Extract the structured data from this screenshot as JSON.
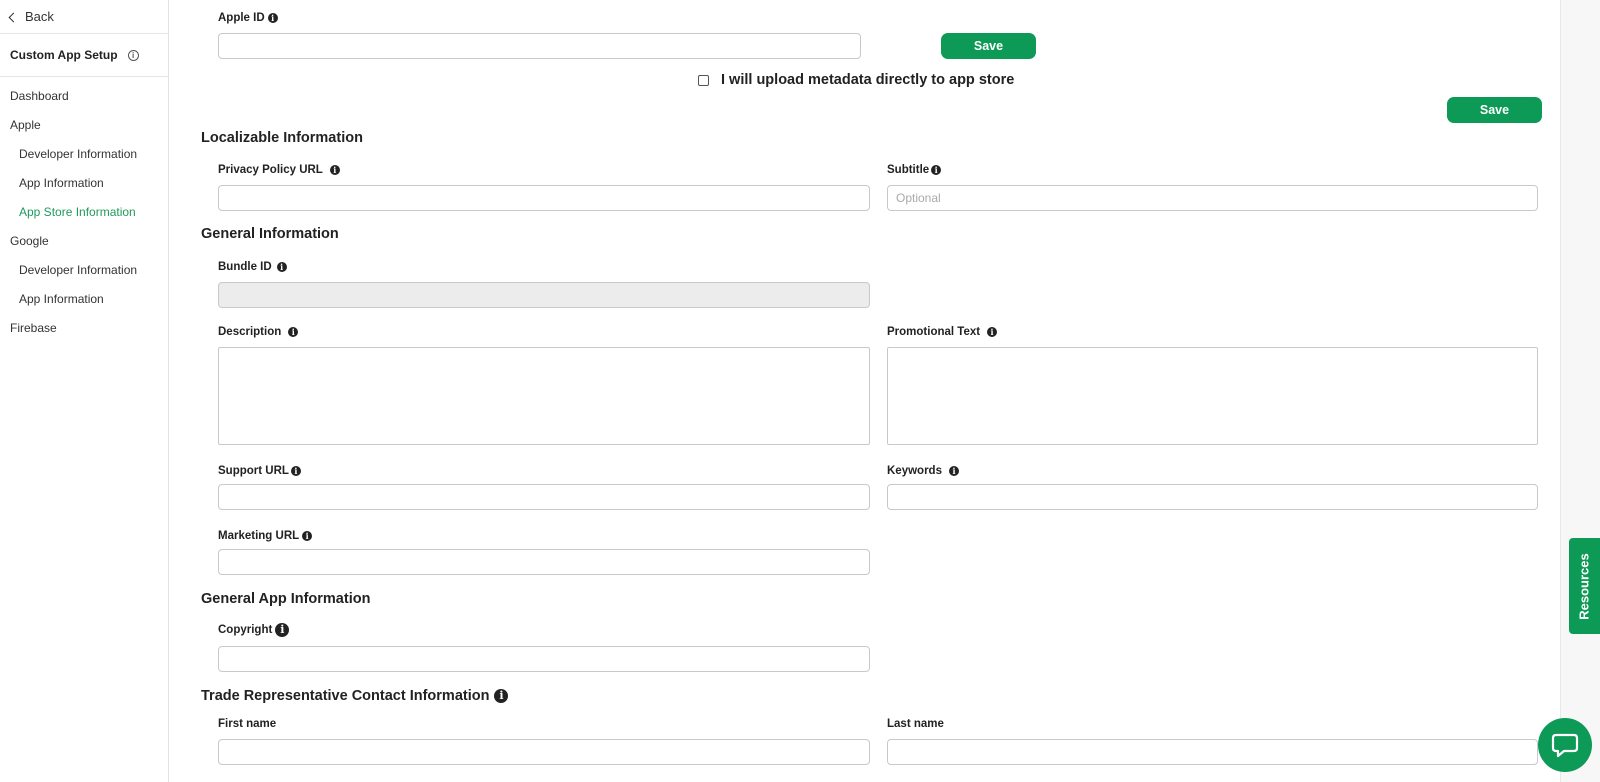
{
  "sidebar": {
    "back_label": "Back",
    "title": "Custom App Setup",
    "items": [
      {
        "label": "Dashboard"
      },
      {
        "label": "Apple"
      },
      {
        "label": "Developer Information"
      },
      {
        "label": "App Information"
      },
      {
        "label": "App Store Information"
      },
      {
        "label": "Google"
      },
      {
        "label": "Developer Information"
      },
      {
        "label": "App Information"
      },
      {
        "label": "Firebase"
      }
    ]
  },
  "form": {
    "apple_id_label": "Apple ID",
    "save_label": "Save",
    "upload_checkbox_label": "I will upload metadata directly to app store",
    "localizable_title": "Localizable Information",
    "privacy_label": "Privacy Policy URL",
    "subtitle_label": "Subtitle",
    "subtitle_placeholder": "Optional",
    "general_title": "General Information",
    "bundle_label": "Bundle ID",
    "description_label": "Description",
    "promo_label": "Promotional Text",
    "support_label": "Support URL",
    "keywords_label": "Keywords",
    "marketing_label": "Marketing URL",
    "general_app_title": "General App Information",
    "copyright_label": "Copyright",
    "trade_title": "Trade Representative Contact Information",
    "first_name_label": "First name",
    "last_name_label": "Last name"
  },
  "widgets": {
    "resources_label": "Resources"
  },
  "colors": {
    "accent": "#0d9a56",
    "active_nav": "#1f9a5b"
  }
}
